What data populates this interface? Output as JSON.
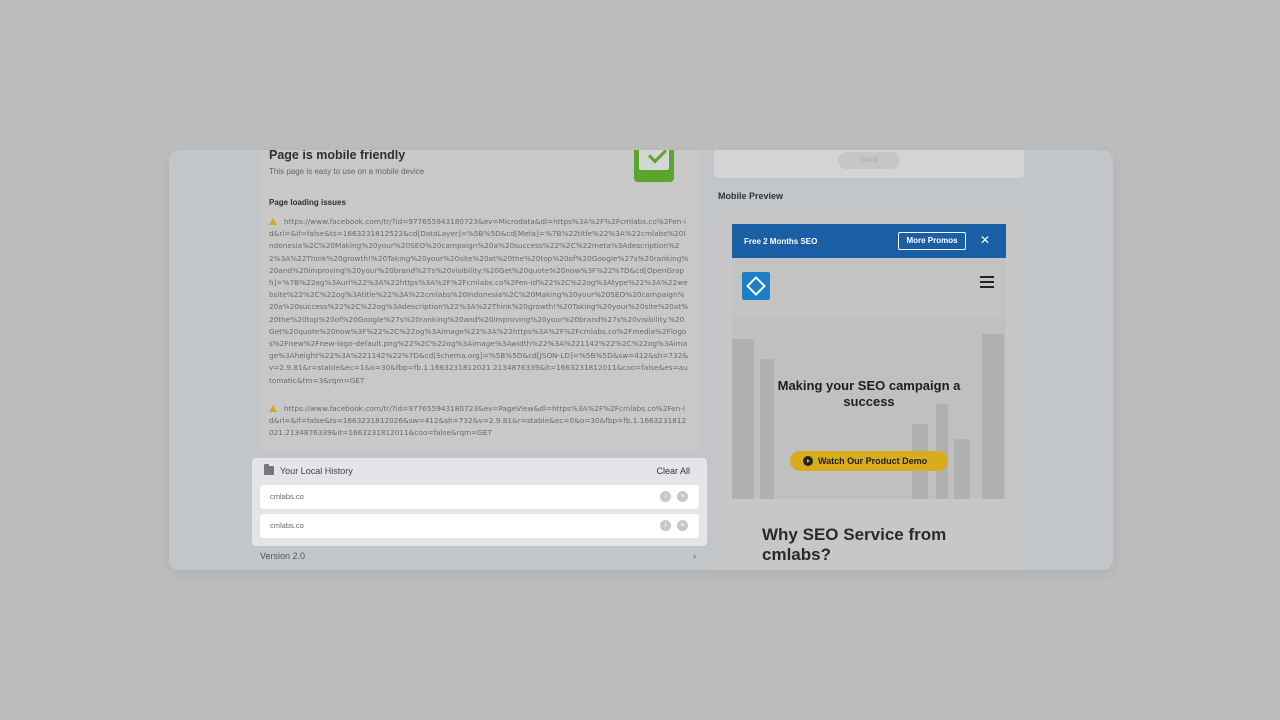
{
  "mobile_friendly": {
    "title": "Page is mobile friendly",
    "description": "This page is easy to use on a mobile device"
  },
  "loading_issues": {
    "title": "Page loading issues",
    "items": [
      "https://www.facebook.com/tr/?id=977655943180723&ev=Microdata&dl=https%3A%2F%2Fcmlabs.co%2Fen-id&rl=&if=false&ts=1663231812522&cd[DataLayer]=%5B%5D&cd[Meta]=%7B%22title%22%3A%22cmlabs%20Indonesia%2C%20Making%20your%20SEO%20campaign%20a%20success%22%2C%22meta%3Adescription%22%3A%22Think%20growth!%20Taking%20your%20site%20at%20the%20top%20of%20Google%27s%20ranking%20and%20improving%20your%20brand%27s%20visibility.%20Get%20quote%20now%3F%22%7D&cd[OpenGraph]=%7B%22og%3Aurl%22%3A%22https%3A%2F%2Fcmlabs.co%2Fen-id%22%2C%22og%3Atype%22%3A%22website%22%2C%22og%3Atitle%22%3A%22cmlabs%20Indonesia%2C%20Making%20your%20SEO%20campaign%20a%20success%22%2C%22og%3Adescription%22%3A%22Think%20growth!%20Taking%20your%20site%20at%20the%20top%20of%20Google%27s%20ranking%20and%20improving%20your%20brand%27s%20visibility.%20Get%20quote%20now%3F%22%2C%22og%3Aimage%22%3A%22https%3A%2F%2Fcmlabs.co%2Fmedia%2Flogos%2Fnew%2Fnew-logo-default.png%22%2C%22og%3Aimage%3Awidth%22%3A%221142%22%2C%22og%3Aimage%3Aheight%22%3A%221142%22%7D&cd[Schema.org]=%5B%5D&cd[JSON-LD]=%5B%5D&sw=412&sh=732&v=2.9.81&r=stable&ec=1&o=30&fbp=fb.1.1663231812021.2134876339&it=1663231812011&coo=false&es=automatic&tm=3&rqm=GET",
      "https://www.facebook.com/tr/?id=977655943180723&ev=PageView&dl=https%3A%2F%2Fcmlabs.co%2Fen-id&rl=&if=false&ts=1663231812026&sw=412&sh=732&v=2.9.81&r=stable&ec=0&o=30&fbp=fb.1.1663231812021.2134876339&it=1663231812011&coo=false&rqm=GET"
    ]
  },
  "history": {
    "title": "Your Local History",
    "clear_label": "Clear All",
    "items": [
      "cmlabs.co",
      "cmlabs.co"
    ]
  },
  "version": "Version 2.0",
  "scroll_label": "Scroll",
  "mobile_preview": {
    "label": "Mobile Preview",
    "banner_text": "Free 2 Months SEO",
    "promo_button": "More Promos",
    "close_glyph": "✕",
    "hero_title": "Making your SEO campaign a success",
    "demo_button": "Watch Our Product Demo",
    "section_title": "Why SEO Service from cmlabs?"
  },
  "colors": {
    "accent_green": "#5aa52e",
    "banner_blue": "#1a5fa6",
    "demo_yellow": "#d9ac1d",
    "warning": "#d9a326"
  },
  "icons": [
    "check-icon",
    "warning-icon",
    "folder-icon",
    "info-icon",
    "close-icon",
    "chevron-right-icon",
    "logo-icon",
    "menu-icon",
    "play-icon"
  ]
}
